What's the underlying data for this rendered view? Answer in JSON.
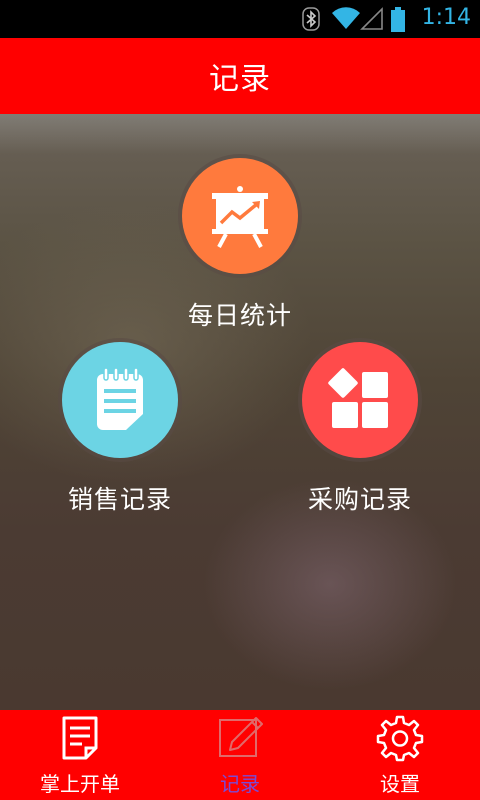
{
  "status_bar": {
    "time": "1:14",
    "icons": [
      "bluetooth-icon",
      "wifi-icon",
      "signal-icon",
      "battery-icon"
    ],
    "color": "#33b5e5"
  },
  "header": {
    "title": "记录",
    "background": "#ff0000"
  },
  "menu": {
    "daily_stats": {
      "label": "每日统计",
      "icon": "presentation-chart-icon",
      "color": "#ff7a3d"
    },
    "sales_records": {
      "label": "销售记录",
      "icon": "notepad-icon",
      "color": "#6cd4e4"
    },
    "purchase_records": {
      "label": "采购记录",
      "icon": "blocks-icon",
      "color": "#ff4b4b"
    }
  },
  "bottom_nav": {
    "items": [
      {
        "label": "掌上开单",
        "icon": "order-sheet-icon",
        "active": false
      },
      {
        "label": "记录",
        "icon": "edit-pencil-icon",
        "active": true
      },
      {
        "label": "设置",
        "icon": "gear-icon",
        "active": false
      }
    ],
    "active_color": "#7a4bd6"
  }
}
